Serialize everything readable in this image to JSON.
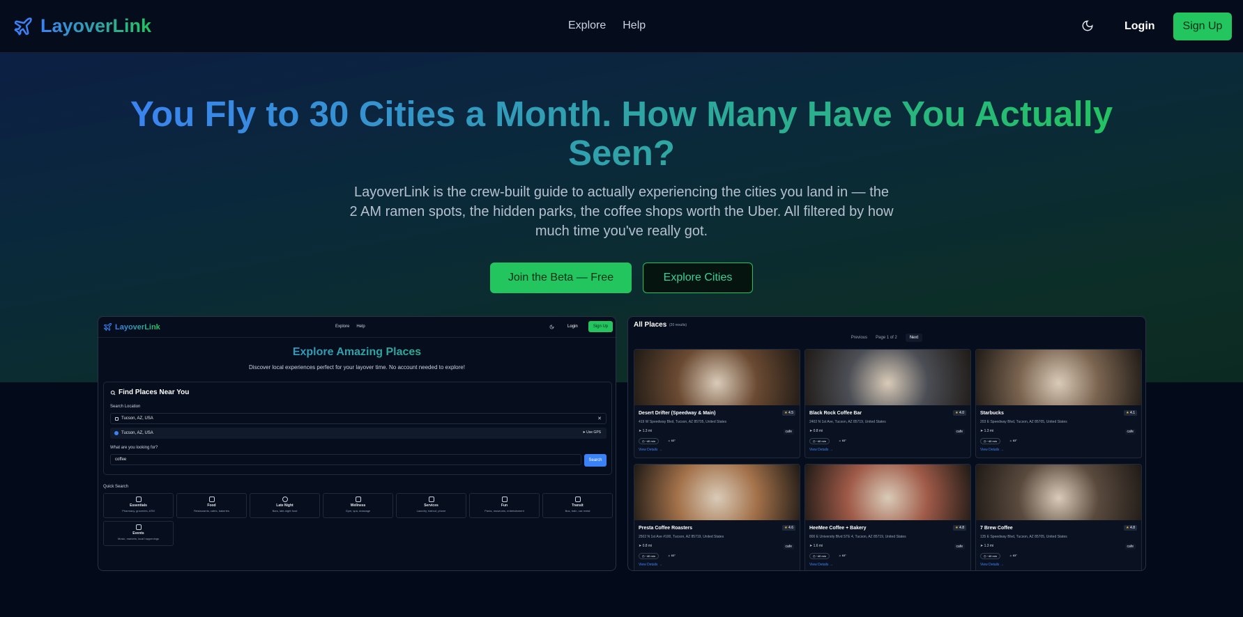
{
  "nav": {
    "brand": "LayoverLink",
    "links": [
      "Explore",
      "Help"
    ],
    "login": "Login",
    "signup": "Sign Up"
  },
  "hero": {
    "title_line1": "You Fly to 30 Cities a Month. How Many Have You Actually",
    "title_line2": "Seen?",
    "subtitle": "LayoverLink is the crew-built guide to actually experiencing the cities you land in — the 2 AM ramen spots, the hidden parks, the coffee shops worth the Uber. All filtered by how much time you've really got.",
    "cta_primary": "Join the Beta — Free",
    "cta_secondary": "Explore Cities"
  },
  "explore_preview": {
    "brand": "LayoverLink",
    "links": [
      "Explore",
      "Help"
    ],
    "login": "Login",
    "signup": "Sign Up",
    "title": "Explore Amazing Places",
    "subtitle": "Discover local experiences perfect for your layover time. No account needed to explore!",
    "find_heading": "Find Places Near You",
    "search_location_label": "Search Location",
    "location_value": "Tucson, AZ, USA",
    "suggestion": "Tucson, AZ, USA",
    "use_gps": "Use GPS",
    "query_label": "What are you looking for?",
    "query_value": "coffee",
    "search_button": "Search",
    "quick_search_label": "Quick Search",
    "quick_search": [
      {
        "name": "Essentials",
        "desc": "Pharmacy, groceries, ATM"
      },
      {
        "name": "Food",
        "desc": "Restaurants, cafes, bakeries"
      },
      {
        "name": "Late Night",
        "desc": "Bars, late-night food"
      },
      {
        "name": "Wellness",
        "desc": "Gym, spa, massage"
      },
      {
        "name": "Services",
        "desc": "Laundry, haircut, phone"
      },
      {
        "name": "Fun",
        "desc": "Parks, museums, entertainment"
      },
      {
        "name": "Transit",
        "desc": "Bus, train, car rental"
      },
      {
        "name": "Events",
        "desc": "Music, markets, local happenings"
      }
    ]
  },
  "places_preview": {
    "heading": "All Places",
    "count": "(20 results)",
    "pager": {
      "prev": "Previous",
      "page": "Page 1 of 2",
      "next": "Next"
    },
    "cards": [
      {
        "name": "Desert Drifter (Speedway & Main)",
        "rating": "4.5",
        "address": "419 W Speedway Blvd, Tucson, AZ 85705, United States",
        "distance": "1.3 mi",
        "category": "cafe",
        "time": "~40 min",
        "temp": "63°",
        "details": "View Details →",
        "img_color": "#6b4a32"
      },
      {
        "name": "Black Rock Coffee Bar",
        "rating": "4.0",
        "address": "2402 N 1st Ave, Tucson, AZ 85719, United States",
        "distance": "0.8 mi",
        "category": "cafe",
        "time": "~40 min",
        "temp": "63°",
        "details": "View Details →",
        "img_color": "#4b4e55"
      },
      {
        "name": "Starbucks",
        "rating": "4.1",
        "address": "203 E Speedway Blvd, Tucson, AZ 85705, United States",
        "distance": "1.3 mi",
        "category": "cafe",
        "time": "~40 min",
        "temp": "63°",
        "details": "View Details →",
        "img_color": "#7a6450"
      },
      {
        "name": "Presta Coffee Roasters",
        "rating": "4.6",
        "address": "2502 N 1st Ave #100, Tucson, AZ 85719, United States",
        "distance": "0.8 mi",
        "category": "cafe",
        "time": "~40 min",
        "temp": "63°",
        "details": "View Details →",
        "img_color": "#a3714a"
      },
      {
        "name": "HeeMee Coffee + Bakery",
        "rating": "4.8",
        "address": "800 E University Blvd STE 4, Tucson, AZ 85719, United States",
        "distance": "1.6 mi",
        "category": "cafe",
        "time": "~40 min",
        "temp": "63°",
        "details": "View Details →",
        "img_color": "#a05a48"
      },
      {
        "name": "7 Brew Coffee",
        "rating": "4.8",
        "address": "135 E Speedway Blvd, Tucson, AZ 85705, United States",
        "distance": "1.3 mi",
        "category": "cafe",
        "time": "~40 min",
        "temp": "63°",
        "details": "View Details →",
        "img_color": "#5a4a3e"
      }
    ]
  },
  "colors": {
    "accent_green": "#22c55e",
    "accent_blue": "#3b82f6",
    "background": "#030a1a"
  },
  "icons": {
    "brand": "plane-icon",
    "theme": "moon-icon",
    "search": "search-icon",
    "star": "star-icon"
  }
}
